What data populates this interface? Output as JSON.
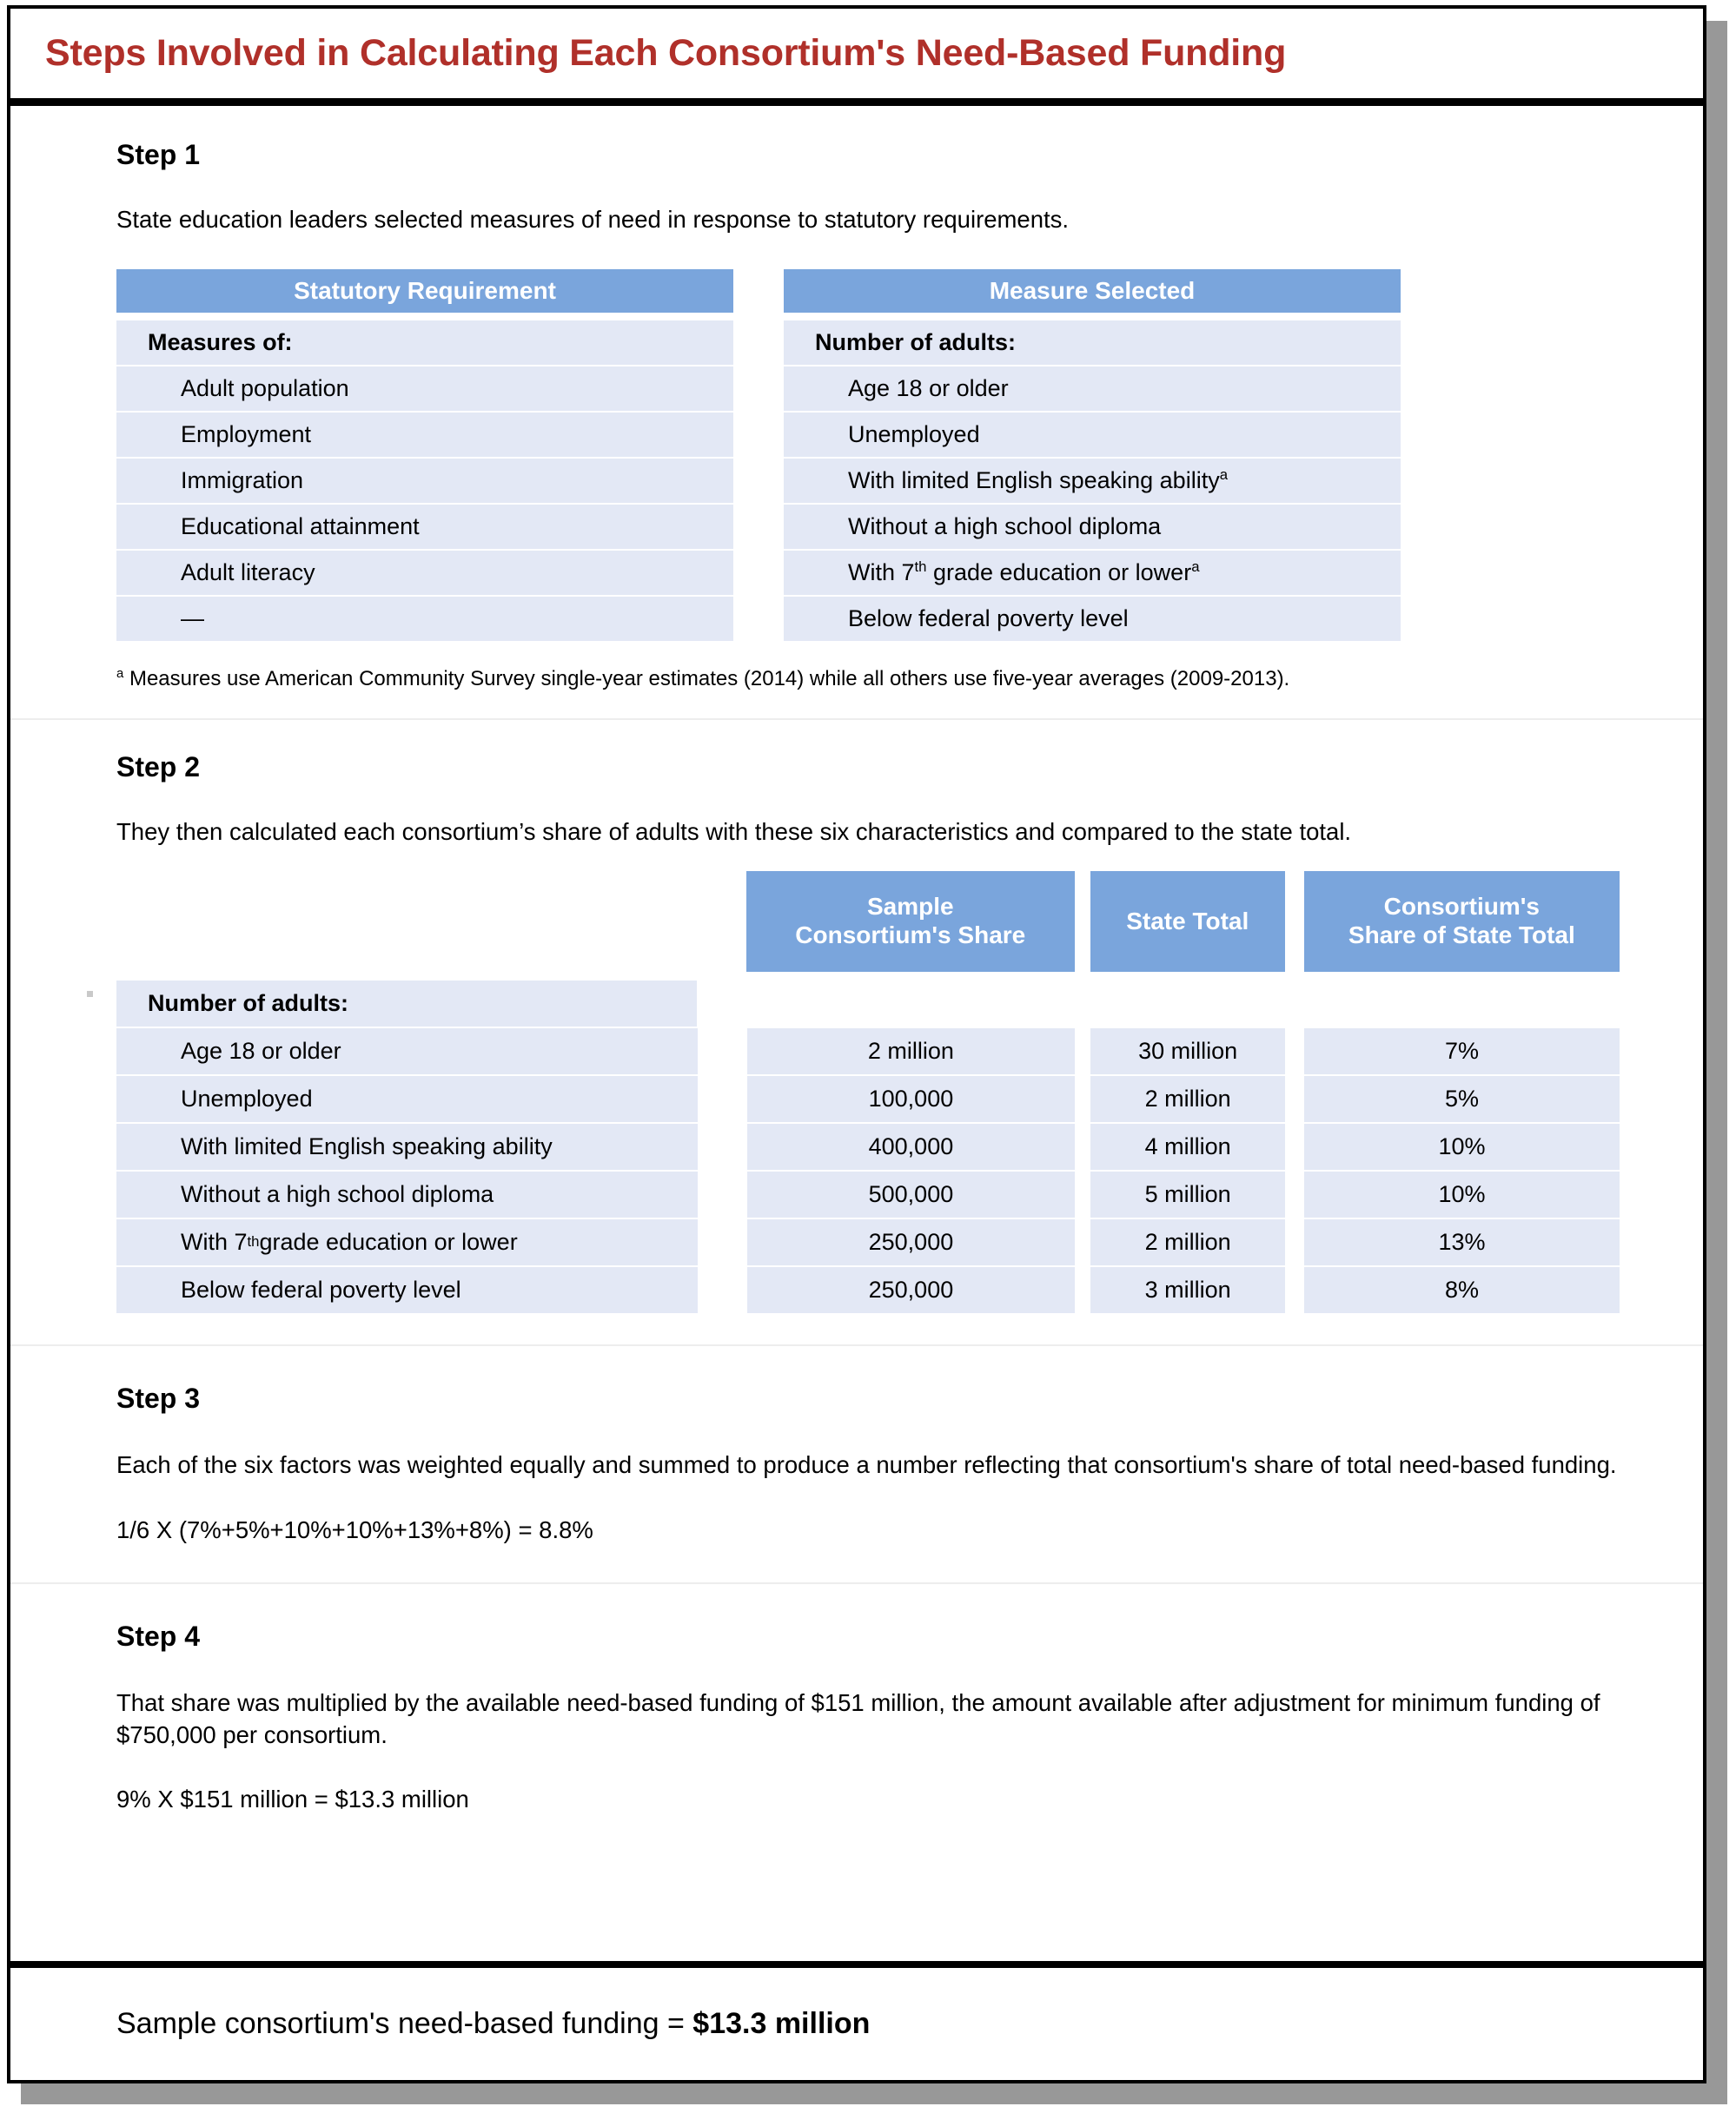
{
  "figure": {
    "title": "Steps Involved in Calculating Each Consortium's Need-Based Funding",
    "title_color": "#B0302A",
    "header_blue": "#7AA5DC",
    "row_blue": "#E3E8F5"
  },
  "step1": {
    "heading": "Step 1",
    "description": "State education leaders selected measures of need in response to statutory requirements.",
    "left_table": {
      "header": "Statutory Requirement",
      "group_label": "Measures of:",
      "rows": [
        "Adult population",
        "Employment",
        "Immigration",
        "Educational attainment",
        "Adult literacy",
        "—"
      ]
    },
    "right_table": {
      "header": "Measure Selected",
      "group_label": "Number of adults:",
      "rows": [
        {
          "text": "Age 18 or older",
          "footnote": ""
        },
        {
          "text": "Unemployed",
          "footnote": ""
        },
        {
          "text": "With limited English speaking ability",
          "footnote": "a"
        },
        {
          "text": "Without a high school diploma",
          "footnote": ""
        },
        {
          "text": "With 7th grade education or lower",
          "prefix": "With 7",
          "sup": "th",
          "suffix": " grade education or lower",
          "footnote": "a"
        },
        {
          "text": "Below federal poverty level",
          "footnote": ""
        }
      ]
    },
    "footnote_marker": "a",
    "footnote_text": "Measures use American Community Survey single-year estimates (2014) while all others use five-year averages (2009-2013)."
  },
  "step2": {
    "heading": "Step 2",
    "description": "They then calculated each consortium’s share of adults with these six characteristics and compared to the state total.",
    "columns": [
      "",
      "Sample\nConsortium's Share",
      "State Total",
      "Consortium's\nShare of State Total"
    ],
    "column_headers": {
      "share_line1": "Sample",
      "share_line2": "Consortium's Share",
      "state_total": "State Total",
      "pct_line1": "Consortium's",
      "pct_line2": "Share of State Total"
    },
    "group_label": "Number of adults:",
    "rows": [
      {
        "label": "Age 18 or older",
        "share": "2 million",
        "state": "30 million",
        "pct": "7%"
      },
      {
        "label": "Unemployed",
        "share": "100,000",
        "state": "2 million",
        "pct": "5%"
      },
      {
        "label": "With limited English speaking ability",
        "share": "400,000",
        "state": "4 million",
        "pct": "10%"
      },
      {
        "label": "Without a high school diploma",
        "share": "500,000",
        "state": "5 million",
        "pct": "10%"
      },
      {
        "label": "With 7th grade education or lower",
        "prefix": "With 7",
        "sup": "th",
        "suffix": " grade education or lower",
        "share": "250,000",
        "state": "2 million",
        "pct": "13%"
      },
      {
        "label": "Below federal poverty level",
        "share": "250,000",
        "state": "3 million",
        "pct": "8%"
      }
    ]
  },
  "step3": {
    "heading": "Step 3",
    "description": "Each of the six factors was weighted equally and summed to produce a number reflecting that consortium's share of total need-based funding.",
    "formula": "1/6 X (7%+5%+10%+10%+13%+8%) = 8.8%"
  },
  "step4": {
    "heading": "Step 4",
    "description": "That share was multiplied by the available need-based funding of $151 million, the amount available after adjustment for minimum funding of $750,000 per consortium.",
    "formula": "9% X $151 million = $13.3 million"
  },
  "result": {
    "label": "Sample consortium's need-based funding = ",
    "value": "$13.3 million"
  },
  "chart_data": {
    "type": "table",
    "title": "Steps Involved in Calculating Each Consortium's Need-Based Funding",
    "categories": [
      "Age 18 or older",
      "Unemployed",
      "With limited English speaking ability",
      "Without a high school diploma",
      "With 7th grade education or lower",
      "Below federal poverty level"
    ],
    "series": [
      {
        "name": "Sample Consortium's Share",
        "values": [
          "2 million",
          "100,000",
          "400,000",
          "500,000",
          "250,000",
          "250,000"
        ]
      },
      {
        "name": "State Total",
        "values": [
          "30 million",
          "2 million",
          "4 million",
          "5 million",
          "2 million",
          "3 million"
        ]
      },
      {
        "name": "Consortium's Share of State Total",
        "values": [
          7,
          5,
          10,
          10,
          13,
          8
        ]
      }
    ],
    "derived": {
      "average_share_percent": 8.8,
      "available_need_based_funding": "$151 million",
      "minimum_funding_per_consortium": "$750,000",
      "sample_consortium_funding": "$13.3 million"
    }
  }
}
